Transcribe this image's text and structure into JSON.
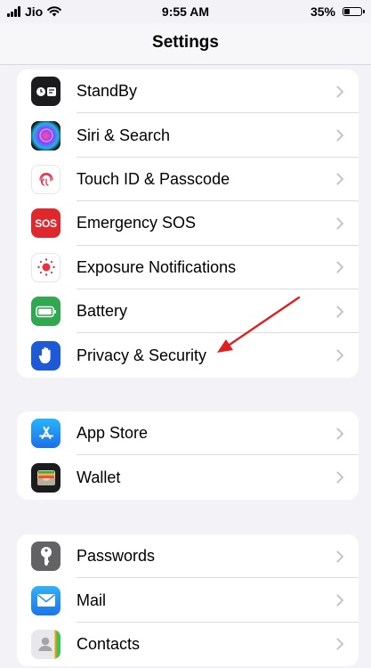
{
  "status_bar": {
    "carrier": "Jio",
    "time": "9:55 AM",
    "battery_percent": "35%",
    "battery_level": 0.35
  },
  "nav": {
    "title": "Settings"
  },
  "groups": [
    {
      "items": [
        {
          "label": "StandBy",
          "icon": "standby-icon",
          "color": "#1c1c1e"
        },
        {
          "label": "Siri & Search",
          "icon": "siri-icon",
          "color": "#1a1a2e"
        },
        {
          "label": "Touch ID & Passcode",
          "icon": "fingerprint-icon",
          "color": "#ffffff"
        },
        {
          "label": "Emergency SOS",
          "icon": "sos-icon",
          "color": "#e0282c",
          "icon_text": "SOS"
        },
        {
          "label": "Exposure Notifications",
          "icon": "exposure-icon",
          "color": "#ffffff"
        },
        {
          "label": "Battery",
          "icon": "battery-icon",
          "color": "#2fa84f"
        },
        {
          "label": "Privacy & Security",
          "icon": "hand-icon",
          "color": "#1e5ad6"
        }
      ]
    },
    {
      "items": [
        {
          "label": "App Store",
          "icon": "app-store-icon",
          "color": "#1f8ef5"
        },
        {
          "label": "Wallet",
          "icon": "wallet-icon",
          "color": "#1c1c1e"
        }
      ]
    },
    {
      "items": [
        {
          "label": "Passwords",
          "icon": "key-icon",
          "color": "#636366"
        },
        {
          "label": "Mail",
          "icon": "mail-icon",
          "color": "#2a8ff0"
        },
        {
          "label": "Contacts",
          "icon": "contacts-icon",
          "color": "#e5e5e7"
        }
      ]
    }
  ],
  "colors": {
    "annotation_arrow": "#e02020",
    "chevron": "#c4c4c7",
    "background": "#f2f2f7"
  }
}
